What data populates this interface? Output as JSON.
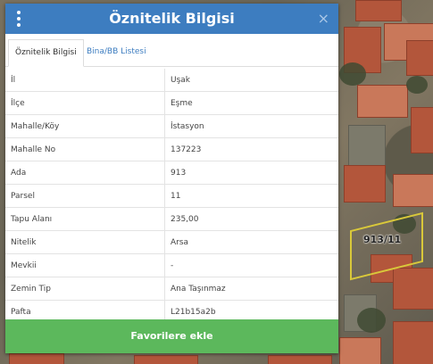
{
  "dialog": {
    "title": "Öznitelik Bilgisi",
    "close_glyph": "×",
    "tabs": [
      {
        "label": "Öznitelik Bilgisi",
        "active": true
      },
      {
        "label": "Bina/BB Listesi",
        "active": false
      }
    ],
    "rows": [
      {
        "key": "İl",
        "value": "Uşak"
      },
      {
        "key": "İlçe",
        "value": "Eşme"
      },
      {
        "key": "Mahalle/Köy",
        "value": "İstasyon"
      },
      {
        "key": "Mahalle No",
        "value": "137223"
      },
      {
        "key": "Ada",
        "value": "913"
      },
      {
        "key": "Parsel",
        "value": "11"
      },
      {
        "key": "Tapu Alanı",
        "value": "235,00"
      },
      {
        "key": "Nitelik",
        "value": "Arsa"
      },
      {
        "key": "Mevkii",
        "value": "-"
      },
      {
        "key": "Zemin Tip",
        "value": "Ana Taşınmaz"
      },
      {
        "key": "Pafta",
        "value": "L21b15a2b"
      }
    ],
    "favorite_button": "Favorilere ekle"
  },
  "map": {
    "parcel_label": "913/11"
  },
  "colors": {
    "titlebar": "#3d7dc0",
    "button": "#5cb85c",
    "parcel_outline": "#d9c83a"
  }
}
